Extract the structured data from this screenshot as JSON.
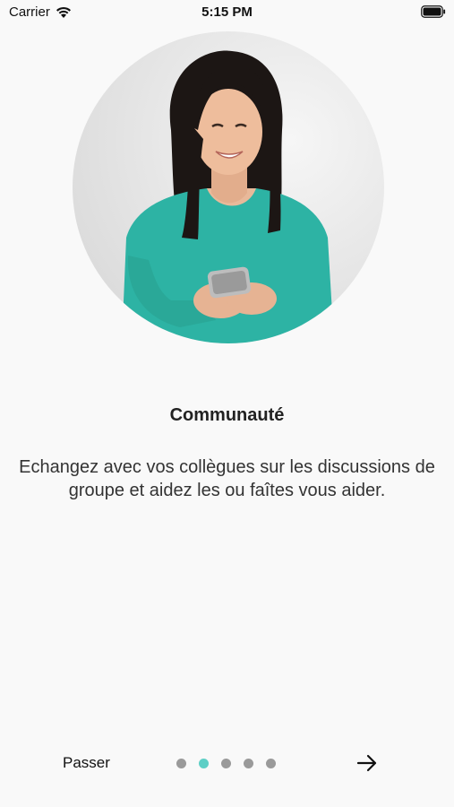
{
  "status_bar": {
    "carrier": "Carrier",
    "time": "5:15 PM",
    "wifi_icon": "wifi-icon",
    "battery_icon": "battery-icon"
  },
  "onboarding": {
    "image": "woman-with-phone-photo",
    "title": "Communauté",
    "description": "Echangez avec vos collègues sur les discussions de groupe et aidez les ou faîtes vous aider.",
    "skip_label": "Passer",
    "page_count": 5,
    "current_page": 2,
    "next_icon": "arrow-right-icon"
  },
  "colors": {
    "background": "#f9f9f9",
    "active_dot": "#5ecfc6",
    "inactive_dot": "#9a9a9a",
    "text": "#222222"
  }
}
